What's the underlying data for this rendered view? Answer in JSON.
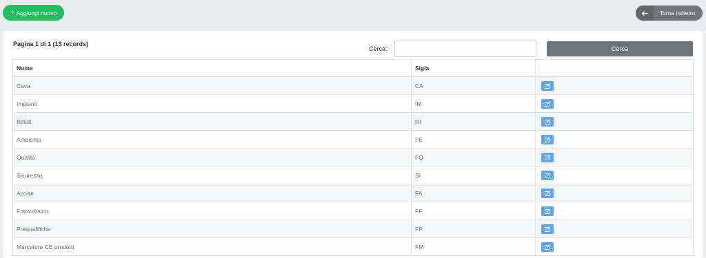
{
  "toolbar": {
    "add_label": "Aggiungi nuovo",
    "back_label": "Torna indietro"
  },
  "paging": {
    "text": "Pagina 1 di 1 (13 records)"
  },
  "search": {
    "label": "Cerca:",
    "value": "",
    "button_label": "Cerca"
  },
  "table": {
    "headers": [
      "Nome",
      "Sigla",
      ""
    ],
    "rows": [
      {
        "nome": "Cava",
        "sigla": "CA"
      },
      {
        "nome": "Impianti",
        "sigla": "IM"
      },
      {
        "nome": "Rifiuti",
        "sigla": "RI"
      },
      {
        "nome": "Ambiente",
        "sigla": "FE"
      },
      {
        "nome": "Qualità",
        "sigla": "FQ"
      },
      {
        "nome": "Sicurezza",
        "sigla": "SI"
      },
      {
        "nome": "Accise",
        "sigla": "FA"
      },
      {
        "nome": "Fotovoltaico",
        "sigla": "FF"
      },
      {
        "nome": "Prequalifiche",
        "sigla": "FP"
      },
      {
        "nome": "Marcature CE prodotti",
        "sigla": "FM"
      }
    ]
  },
  "icons": {
    "add": "plus-icon",
    "back": "back-arrow-icon",
    "edit": "edit-icon"
  },
  "colors": {
    "add": "#22bf62",
    "secondary": "#6c757d",
    "edit": "#5aa9ee"
  }
}
